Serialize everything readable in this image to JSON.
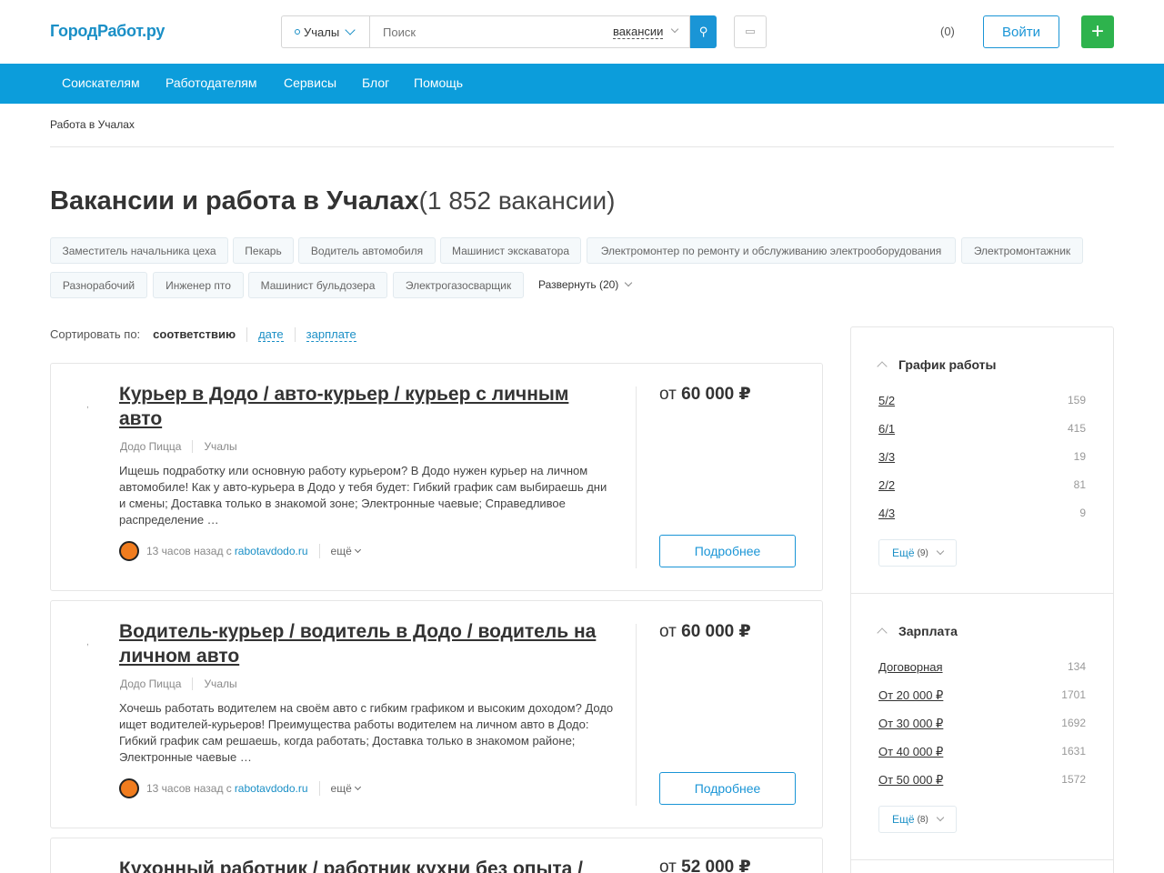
{
  "header": {
    "logo": "ГородРабот.ру",
    "city": "Учалы",
    "search_placeholder": "Поиск",
    "search_type": "вакансии",
    "favorites": "(0)",
    "login": "Войти",
    "plus": "+"
  },
  "nav": [
    "Соискателям",
    "Работодателям",
    "Сервисы",
    "Блог",
    "Помощь"
  ],
  "breadcrumb": "Работа в Учалах",
  "page": {
    "title": "Вакансии и работа в Учалах",
    "count": "(1 852 вакансии)"
  },
  "tags": [
    "Заместитель начальника цеха",
    "Пекарь",
    "Водитель автомобиля",
    "Машинист экскаватора",
    "Электромонтер по ремонту и обслуживанию электрооборудования",
    "Электромонтажник",
    "Разнорабочий",
    "Инженер пто",
    "Машинист бульдозера",
    "Электрогазосварщик"
  ],
  "expand": "Развернуть (20)",
  "sort": {
    "label": "Сортировать по:",
    "active": "соответствию",
    "options": [
      "дате",
      "зарплате"
    ]
  },
  "vacancies": [
    {
      "title": "Курьер в Додо / авто-курьер / курьер с личным авто",
      "company": "Додо Пицца",
      "city": "Учалы",
      "description": "Ищешь подработку или основную работу курьером? В Додо нужен курьер на личном автомобиле! Как у авто-курьера в Додо у тебя будет: Гибкий график сам выбираешь дни и смены; Доставка только в знакомой зоне; Электронные чаевые; Справедливое распределение …",
      "time": "13 часов назад с",
      "source": "rabotavdodo.ru",
      "more": "ещё",
      "salary_prefix": "от",
      "salary": "60 000",
      "currency": "₽",
      "details": "Подробнее"
    },
    {
      "title": "Водитель-курьер / водитель в Додо / водитель на личном авто",
      "company": "Додо Пицца",
      "city": "Учалы",
      "description": "Хочешь работать водителем на своём авто с гибким графиком и высоким доходом? Додо ищет водителей-курьеров! Преимущества работы водителем на личном авто в Додо: Гибкий график сам решаешь, когда работать; Доставка только в знакомом районе; Электронные чаевые …",
      "time": "13 часов назад с",
      "source": "rabotavdodo.ru",
      "more": "ещё",
      "salary_prefix": "от",
      "salary": "60 000",
      "currency": "₽",
      "details": "Подробнее"
    },
    {
      "title": "Кухонный работник / работник кухни без опыта /",
      "salary_prefix": "от",
      "salary": "52 000",
      "currency": "₽"
    }
  ],
  "filters": [
    {
      "title": "График работы",
      "items": [
        {
          "label": "5/2",
          "count": "159"
        },
        {
          "label": "6/1",
          "count": "415"
        },
        {
          "label": "3/3",
          "count": "19"
        },
        {
          "label": "2/2",
          "count": "81"
        },
        {
          "label": "4/3",
          "count": "9"
        }
      ],
      "more": "Ещё",
      "more_count": "(9)"
    },
    {
      "title": "Зарплата",
      "items": [
        {
          "label": "Договорная",
          "count": "134"
        },
        {
          "label": "От 20 000 ₽",
          "count": "1701"
        },
        {
          "label": "От 30 000 ₽",
          "count": "1692"
        },
        {
          "label": "От 40 000 ₽",
          "count": "1631"
        },
        {
          "label": "От 50 000 ₽",
          "count": "1572"
        }
      ],
      "more": "Ещё",
      "more_count": "(8)"
    }
  ],
  "colors": {
    "brand": "#0c9ddb",
    "accent": "#1a95d6",
    "green": "#2eb34d"
  }
}
